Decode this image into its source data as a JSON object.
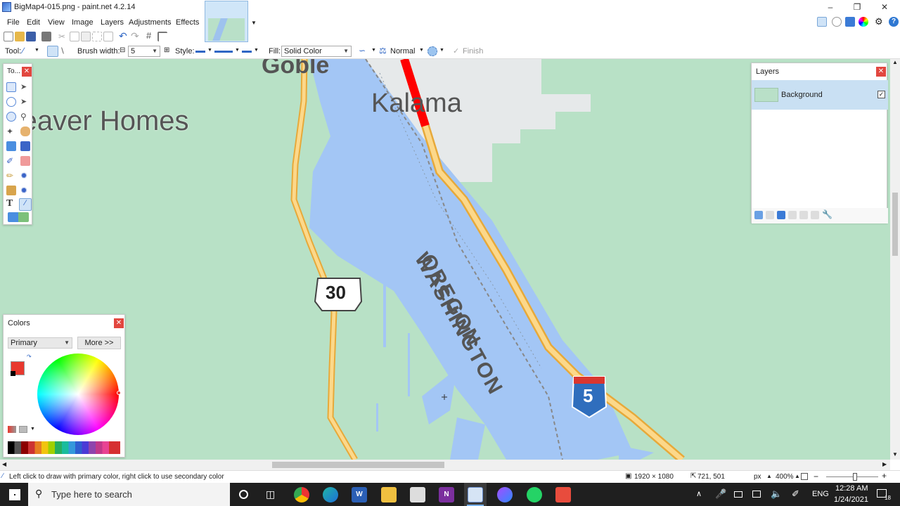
{
  "window": {
    "title": "BigMap4-015.png - paint.net 4.2.14"
  },
  "menu": [
    "File",
    "Edit",
    "View",
    "Image",
    "Layers",
    "Adjustments",
    "Effects"
  ],
  "toolbar": {
    "tool_label": "Tool:",
    "brush_width_label": "Brush width:",
    "brush_width_value": "5",
    "style_label": "Style:",
    "fill_label": "Fill:",
    "fill_value": "Solid Color",
    "blend_value": "Normal",
    "finish_label": "Finish"
  },
  "tools_panel": {
    "title": "To..."
  },
  "layers_panel": {
    "title": "Layers",
    "layers": [
      {
        "name": "Background",
        "visible": true
      }
    ]
  },
  "colors_panel": {
    "title": "Colors",
    "mode": "Primary",
    "more_button": "More >>",
    "primary_color": "#e8382e",
    "secondary_color": "#ffffff"
  },
  "map": {
    "labels": {
      "gobie": "Goble",
      "beaver_homes": "Beaver Homes",
      "kalama": "Kalama",
      "washington": "WASHINGTON",
      "oregon": "OREGON",
      "us30": "30",
      "i5": "5"
    },
    "colors": {
      "land": "#b8e1c6",
      "water": "#a3c6f5",
      "road": "#f7c25a",
      "urban": "#e6e9ea",
      "highlight": "#ff0000"
    }
  },
  "statusbar": {
    "hint": "Left click to draw with primary color, right click to use secondary color",
    "image_size": "1920 × 1080",
    "cursor_pos": "721, 501",
    "units": "px",
    "zoom": "400%"
  },
  "taskbar": {
    "search_placeholder": "Type here to search",
    "time": "12:28 AM",
    "date": "1/24/2021",
    "language": "ENG",
    "notifications": "18"
  }
}
